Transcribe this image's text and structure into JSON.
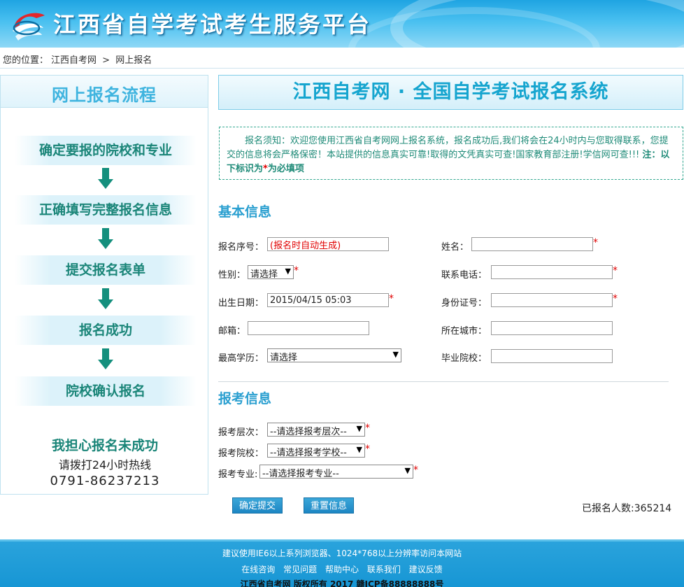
{
  "header": {
    "title": "江西省自学考试考生服务平台"
  },
  "breadcrumb": {
    "prefix": "您的位置：",
    "home": "江西自考网",
    "separator": ">",
    "current": "网上报名"
  },
  "sidebar": {
    "heading": "网上报名流程",
    "steps": [
      "确定要报的院校和专业",
      "正确填写完整报名信息",
      "提交报名表单",
      "报名成功",
      "院校确认报名"
    ],
    "worry_title": "我担心报名未成功",
    "worry_hint": "请拨打24小时热线",
    "hotline": "0791-86237213"
  },
  "main": {
    "banner": "江西自考网 · 全国自学考试报名系统",
    "notice_text": "报名须知：欢迎您使用江西省自考网网上报名系统，报名成功后,我们将会在24小时内与您取得联系，您提交的信息将会严格保密！本站提供的信息真实可靠!取得的文凭真实可查!国家教育部注册!学信网可查!!! ",
    "notice_bold_prefix": "注：以下标识为",
    "notice_star": "*",
    "notice_bold_suffix": "为必填项",
    "required_mark": "*"
  },
  "basic_info": {
    "title": "基本信息",
    "serial_label": "报名序号：",
    "serial_value": "(报名时自动生成)",
    "name_label": "姓名：",
    "name_value": "",
    "gender_label": "性别：",
    "gender_value": "请选择",
    "phone_label": "联系电话：",
    "phone_value": "",
    "birth_label": "出生日期：",
    "birth_value": "2015/04/15 05:03",
    "id_label": "身份证号：",
    "id_value": "",
    "email_label": "邮箱：",
    "email_value": "",
    "city_label": "所在城市：",
    "city_value": "",
    "education_label": "最高学历：",
    "education_value": "请选择",
    "school_label": "毕业院校：",
    "school_value": ""
  },
  "exam_info": {
    "title": "报考信息",
    "level_label": "报考层次：",
    "level_value": "--请选择报考层次--",
    "college_label": "报考院校：",
    "college_value": "--请选择报考学校--",
    "major_label": "报考专业:",
    "major_value": "--请选择报考专业--"
  },
  "actions": {
    "submit": "确定提交",
    "reset": "重置信息",
    "count_label": "已报名人数:",
    "count_value": "365214"
  },
  "footer": {
    "notice": "建议使用IE6以上系列浏览器、1024*768以上分辨率访问本网站",
    "links": [
      "在线咨询",
      "常见问题",
      "帮助中心",
      "联系我们",
      "建议反馈"
    ],
    "copyright": "江西省自考网 版权所有 2017 赣ICP备88888888号"
  },
  "icons": {
    "logo": "swirl-logo-icon",
    "dropdown": "caret-down-icon",
    "flow_arrow": "arrow-down-icon"
  },
  "colors": {
    "header_blue": "#1fa4e2",
    "teal": "#1a8578",
    "title_blue": "#2a9fd0",
    "required_red": "#e00000",
    "button_blue": "#1d86c4"
  }
}
